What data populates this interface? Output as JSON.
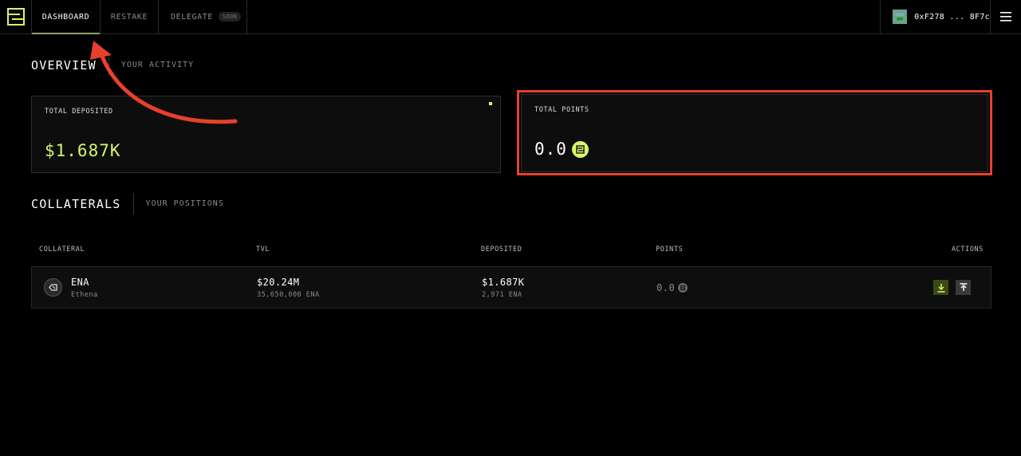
{
  "nav": {
    "tabs": [
      {
        "label": "DASHBOARD",
        "active": true
      },
      {
        "label": "RESTAKE",
        "active": false
      },
      {
        "label": "DELEGATE",
        "active": false,
        "badge": "SOON"
      }
    ],
    "wallet_address": "0xF278 ... 8F7c",
    "logo_icon": "stack-logo-icon",
    "menu_icon": "hamburger-menu-icon"
  },
  "overview": {
    "title": "OVERVIEW",
    "subtitle": "YOUR ACTIVITY",
    "total_deposited": {
      "label": "TOTAL DEPOSITED",
      "value": "$1.687K"
    },
    "total_points": {
      "label": "TOTAL POINTS",
      "value": "0.0"
    }
  },
  "collaterals": {
    "title": "COLLATERALS",
    "subtitle": "YOUR POSITIONS",
    "columns": [
      "COLLATERAL",
      "TVL",
      "DEPOSITED",
      "POINTS",
      "ACTIONS"
    ],
    "rows": [
      {
        "symbol": "ENA",
        "name": "Ethena",
        "tvl": "$20.24M",
        "tvl_sub": "35,650,000 ENA",
        "deposited": "$1.687K",
        "deposited_sub": "2,971 ENA",
        "points": "0.0"
      }
    ]
  },
  "colors": {
    "accent": "#d6f76b",
    "annotation": "#e8402a",
    "background": "#000000"
  }
}
